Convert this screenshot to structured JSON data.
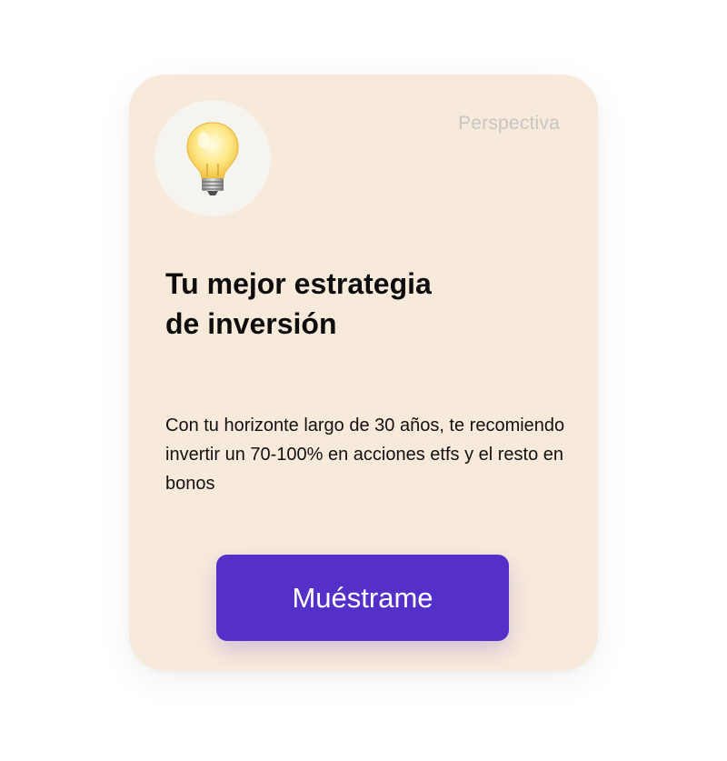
{
  "card": {
    "tag_label": "Perspectiva",
    "icon": "lightbulb-icon",
    "title": "Tu mejor estrategia de inversión",
    "description": "Con tu horizonte largo de 30 años, te recomiendo invertir un 70-100% en acciones etfs y el resto en bonos",
    "cta_label": "Muéstrame"
  },
  "colors": {
    "card_background": "#f8eadb",
    "accent": "#5530c8",
    "tag_text": "#c6c6c6",
    "icon_circle": "#f6f4ef"
  }
}
